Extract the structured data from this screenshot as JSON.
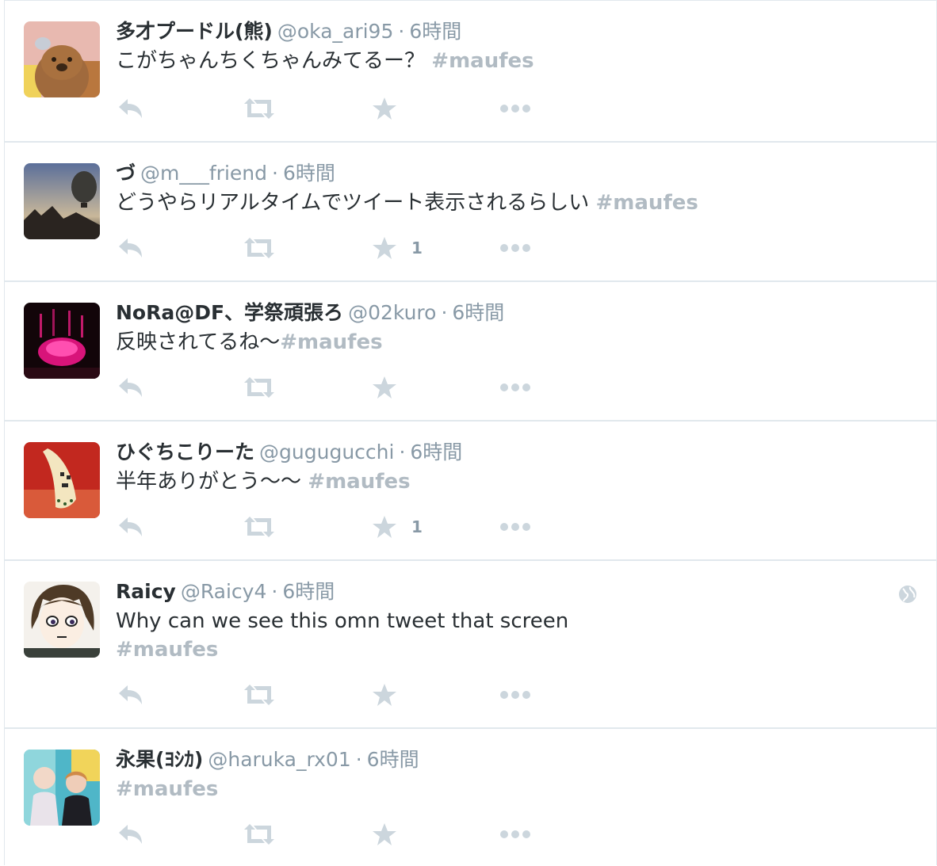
{
  "tweets": [
    {
      "fullname": "多才プードル(熊)",
      "username": "@oka_ari95",
      "separator": "·",
      "time": "6時間",
      "text": "こがちゃんちくちゃんみてるー？ ",
      "hashtag": {
        "hash": "#",
        "tag": "maufes"
      },
      "favorite_count": "",
      "avatar_icon": "bear-avatar"
    },
    {
      "fullname": "づ",
      "username": "@m___friend",
      "separator": "·",
      "time": "6時間",
      "text": "どうやらリアルタイムでツイート表示されるらしい ",
      "hashtag": {
        "hash": "#",
        "tag": "maufes"
      },
      "favorite_count": "1",
      "avatar_icon": "balloon-avatar"
    },
    {
      "fullname": "NoRa@DF、学祭頑張ろ",
      "username": "@02kuro",
      "separator": "·",
      "time": "6時間",
      "text": "反映されてるね〜",
      "hashtag": {
        "hash": "#",
        "tag": "maufes"
      },
      "favorite_count": "",
      "avatar_icon": "pink-light-avatar"
    },
    {
      "fullname": "ひぐちこりーた",
      "username": "@gugugucchi",
      "separator": "·",
      "time": "6時間",
      "text": "半年ありがとう〜〜 ",
      "hashtag": {
        "hash": "#",
        "tag": "maufes"
      },
      "favorite_count": "1",
      "avatar_icon": "banana-avatar"
    },
    {
      "fullname": "Raicy",
      "username": "@Raicy4",
      "separator": "·",
      "time": "6時間",
      "text": "Why can we see this omn tweet that screen",
      "hashtag": {
        "hash": "#",
        "tag": "maufes"
      },
      "favorite_count": "",
      "avatar_icon": "anime-avatar",
      "globe_icon": "globe-icon"
    },
    {
      "fullname": "永果(ﾖｼｶ)",
      "username": "@haruka_rx01",
      "separator": "·",
      "time": "6時間",
      "text": "",
      "hashtag": {
        "hash": "#",
        "tag": "maufes"
      },
      "favorite_count": "",
      "avatar_icon": "photo-avatar"
    }
  ],
  "colors": {
    "name": "#292f33",
    "meta": "#8899a6",
    "hashtag": "#b1bbc3",
    "action_icon": "#ccd6dd",
    "divider": "#e1e8ed"
  },
  "icons": [
    "reply-icon",
    "retweet-icon",
    "favorite-icon",
    "more-icon",
    "globe-icon"
  ]
}
